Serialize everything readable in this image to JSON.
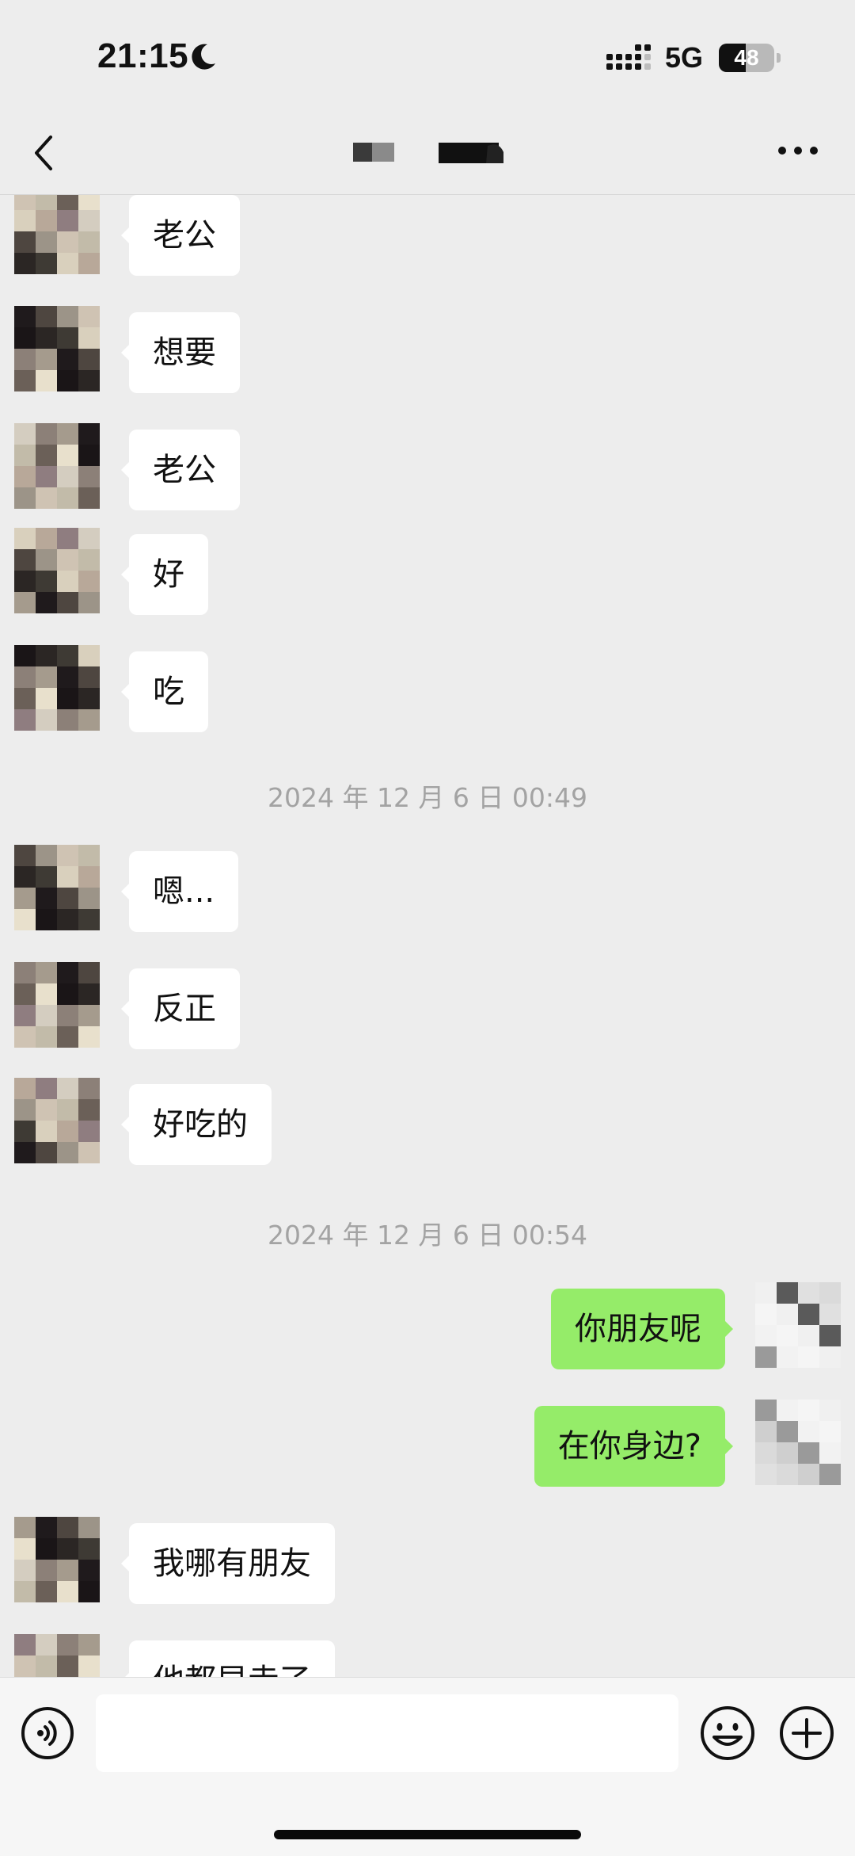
{
  "status_bar": {
    "time": "21:15",
    "network": "5G",
    "battery": 48,
    "battery_label": "48",
    "icons": [
      "moon-icon",
      "signal-icon",
      "battery-icon"
    ]
  },
  "nav": {
    "icons": [
      "back-icon",
      "more-icon"
    ]
  },
  "colors": {
    "background": "#ededed",
    "incoming_bubble": "#ffffff",
    "outgoing_bubble": "#95ec69",
    "timestamp": "#a3a3a3"
  },
  "messages": [
    {
      "type": "in",
      "text": "老公"
    },
    {
      "type": "in",
      "text": "想要"
    },
    {
      "type": "in",
      "text": "老公"
    },
    {
      "type": "in",
      "text": "好"
    },
    {
      "type": "in",
      "text": "吃"
    },
    {
      "type": "time",
      "text": "2024 年 12 月 6 日 00:49"
    },
    {
      "type": "in",
      "text": "嗯..."
    },
    {
      "type": "in",
      "text": "反正"
    },
    {
      "type": "in",
      "text": "好吃的"
    },
    {
      "type": "time",
      "text": "2024 年 12 月 6 日 00:54"
    },
    {
      "type": "out",
      "text": "你朋友呢"
    },
    {
      "type": "out",
      "text": "在你身边?"
    },
    {
      "type": "in",
      "text": "我哪有朋友"
    },
    {
      "type": "in",
      "text": "他都早走了"
    }
  ],
  "input_bar": {
    "value": "",
    "placeholder": "",
    "icons": [
      "voice-icon",
      "emoji-icon",
      "plus-icon"
    ]
  }
}
